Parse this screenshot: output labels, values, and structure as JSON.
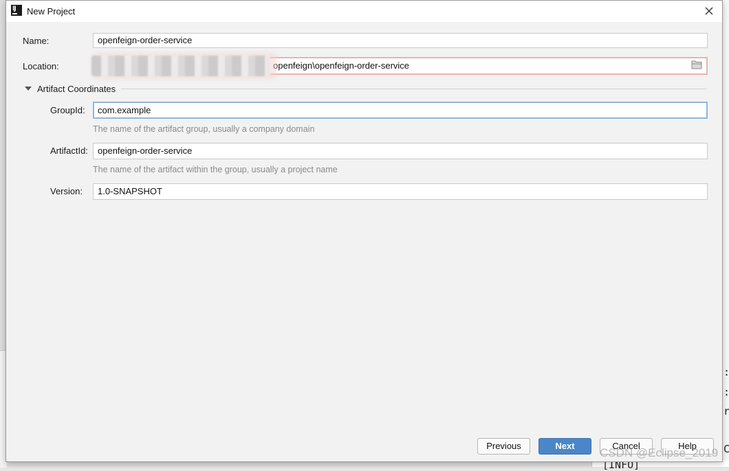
{
  "dialog": {
    "title": "New Project"
  },
  "form": {
    "name_label": "Name:",
    "name_value": "openfeign-order-service",
    "location_label": "Location:",
    "location_value": "openfeign\\openfeign-order-service",
    "section_title": "Artifact Coordinates",
    "groupid_label": "GroupId:",
    "groupid_value": "com.example",
    "groupid_hint": "The name of the artifact group, usually a company domain",
    "artifactid_label": "ArtifactId:",
    "artifactid_value": "openfeign-order-service",
    "artifactid_hint": "The name of the artifact within the group, usually a project name",
    "version_label": "Version:",
    "version_value": "1.0-SNAPSHOT"
  },
  "buttons": {
    "previous": "Previous",
    "next": "Next",
    "cancel": "Cancel",
    "help": "Help"
  },
  "background": {
    "right_glyphs": [
      ":",
      ":",
      "r",
      "C"
    ],
    "bottom_text": "[INFO]"
  },
  "watermark": "CSDN @Eclipse_2019",
  "colors": {
    "primary_button": "#4a86c8",
    "focus_border": "#8fb6dd",
    "error_border": "#e7b4b4"
  },
  "icons": {
    "close": "close-icon",
    "folder": "folder-icon",
    "collapse": "triangle-down-icon",
    "app": "intellij-logo"
  }
}
